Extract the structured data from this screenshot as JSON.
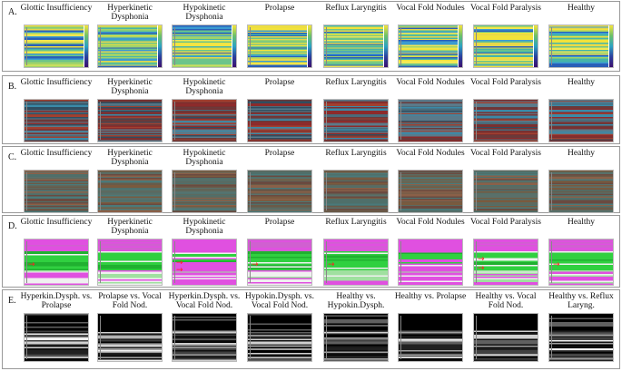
{
  "rows": [
    {
      "label": "A.",
      "kind": "A",
      "titles": [
        "Glottic Insufficiency",
        "Hyperkinetic Dysphonia",
        "Hypokinetic Dysphonia",
        "Prolapse",
        "Reflux Laryngitis",
        "Vocal Fold Nodules",
        "Vocal Fold Paralysis",
        "Healthy"
      ]
    },
    {
      "label": "B.",
      "kind": "B",
      "titles": [
        "Glottic Insufficiency",
        "Hyperkinetic Dysphonia",
        "Hypokinetic Dysphonia",
        "Prolapse",
        "Reflux Laryngitis",
        "Vocal Fold Nodules",
        "Vocal Fold Paralysis",
        "Healthy"
      ]
    },
    {
      "label": "C.",
      "kind": "C",
      "titles": [
        "Glottic Insufficiency",
        "Hyperkinetic Dysphonia",
        "Hypokinetic Dysphonia",
        "Prolapse",
        "Reflux Laryngitis",
        "Vocal Fold Nodules",
        "Vocal Fold Paralysis",
        "Healthy"
      ]
    },
    {
      "label": "D.",
      "kind": "D",
      "titles": [
        "Glottic Insufficiency",
        "Hyperkinetic Dysphonia",
        "Hypokinetic Dysphonia",
        "Prolapse",
        "Reflux Laryngitis",
        "Vocal Fold Nodules",
        "Vocal Fold Paralysis",
        "Healthy"
      ]
    },
    {
      "label": "E.",
      "kind": "E",
      "titles": [
        "Hyperkin.Dysph. vs. Prolapse",
        "Prolapse vs. Vocal Fold Nod.",
        "Hyperkin.Dysph. vs. Vocal Fold Nod.",
        "Hypokin.Dysph. vs. Vocal Fold Nod.",
        "Healthy vs. Hypokin.Dysph.",
        "Healthy vs. Prolapse",
        "Healthy vs. Vocal Fold Nod.",
        "Healthy vs. Reflux Laryng."
      ]
    }
  ],
  "colors": {
    "panel_border": "#999999",
    "arrow": "#ff2020"
  }
}
